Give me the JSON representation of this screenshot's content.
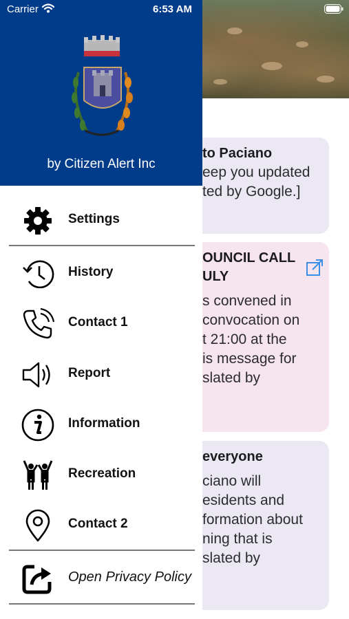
{
  "status_bar": {
    "carrier": "Carrier",
    "time": "6:53 AM"
  },
  "drawer": {
    "header_subtitle": "by Citizen Alert Inc",
    "header_color": "#003c8a",
    "menu": [
      {
        "label": "Settings",
        "icon": "gear-icon"
      },
      {
        "label": "History",
        "icon": "history-clock-icon"
      },
      {
        "label": "Contact 1",
        "icon": "phone-icon"
      },
      {
        "label": "Report",
        "icon": "speaker-icon"
      },
      {
        "label": "Information",
        "icon": "info-icon"
      },
      {
        "label": "Recreation",
        "icon": "people-cheering-icon"
      },
      {
        "label": "Contact 2",
        "icon": "location-pin-icon"
      },
      {
        "label": "Open Privacy Policy",
        "icon": "share-open-icon"
      }
    ]
  },
  "background": {
    "cards": [
      {
        "title": "to Paciano",
        "body": [
          "eep you updated",
          "ted by Google.]"
        ],
        "color": "#ece8f3"
      },
      {
        "title": [
          "OUNCIL CALL",
          "ULY"
        ],
        "body": [
          "s convened in",
          "convocation on",
          "t 21:00 at the",
          "is message for",
          "slated by"
        ],
        "color": "#f6e4ef"
      },
      {
        "title": "everyone",
        "body": [
          "ciano will",
          "esidents and",
          "formation about",
          "ning that is",
          "slated by"
        ],
        "color": "#ece8f3"
      }
    ]
  }
}
